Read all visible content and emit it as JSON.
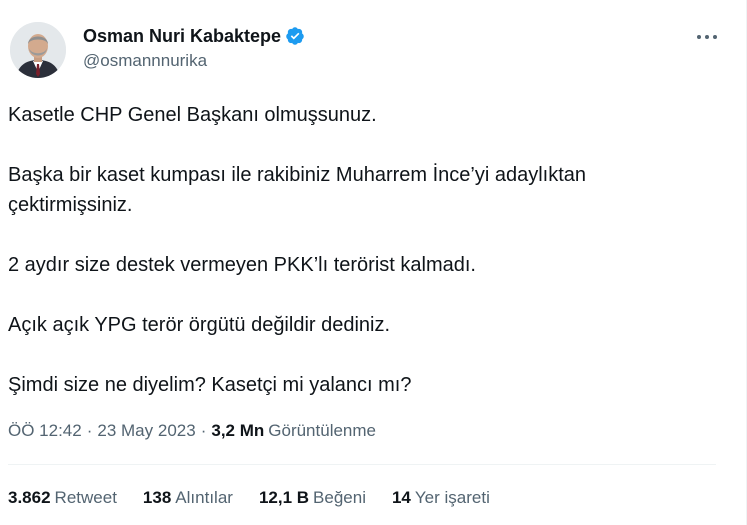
{
  "author": {
    "name": "Osman Nuri Kabaktepe",
    "handle": "@osmannnurika",
    "verified": true,
    "verified_color": "#1d9bf0"
  },
  "tweet": {
    "paragraphs": [
      "Kasetle CHP Genel Başkanı olmuşsunuz.",
      "Başka bir kaset kumpası ile rakibiniz Muharrem İnce’yi adaylıktan çektirmişsiniz.",
      "2 aydır size destek vermeyen PKK’lı terörist kalmadı.",
      "Açık açık YPG terör örgütü değildir dediniz.",
      "Şimdi size ne diyelim? Kasetçi mi yalancı mı?"
    ],
    "time": "ÖÖ 12:42",
    "separator": "·",
    "date": "23 May 2023",
    "views_count": "3,2 Mn",
    "views_label": "Görüntülenme"
  },
  "stats": {
    "retweets": {
      "count": "3.862",
      "label": "Retweet"
    },
    "quotes": {
      "count": "138",
      "label": "Alıntılar"
    },
    "likes": {
      "count": "12,1 B",
      "label": "Beğeni"
    },
    "bookmarks": {
      "count": "14",
      "label": "Yer işareti"
    }
  },
  "icons": {
    "more": "more-options-icon",
    "verified": "verified-badge-icon"
  },
  "colors": {
    "text_primary": "#0f1419",
    "text_secondary": "#536471",
    "divider": "#eff3f4",
    "accent": "#1d9bf0"
  }
}
